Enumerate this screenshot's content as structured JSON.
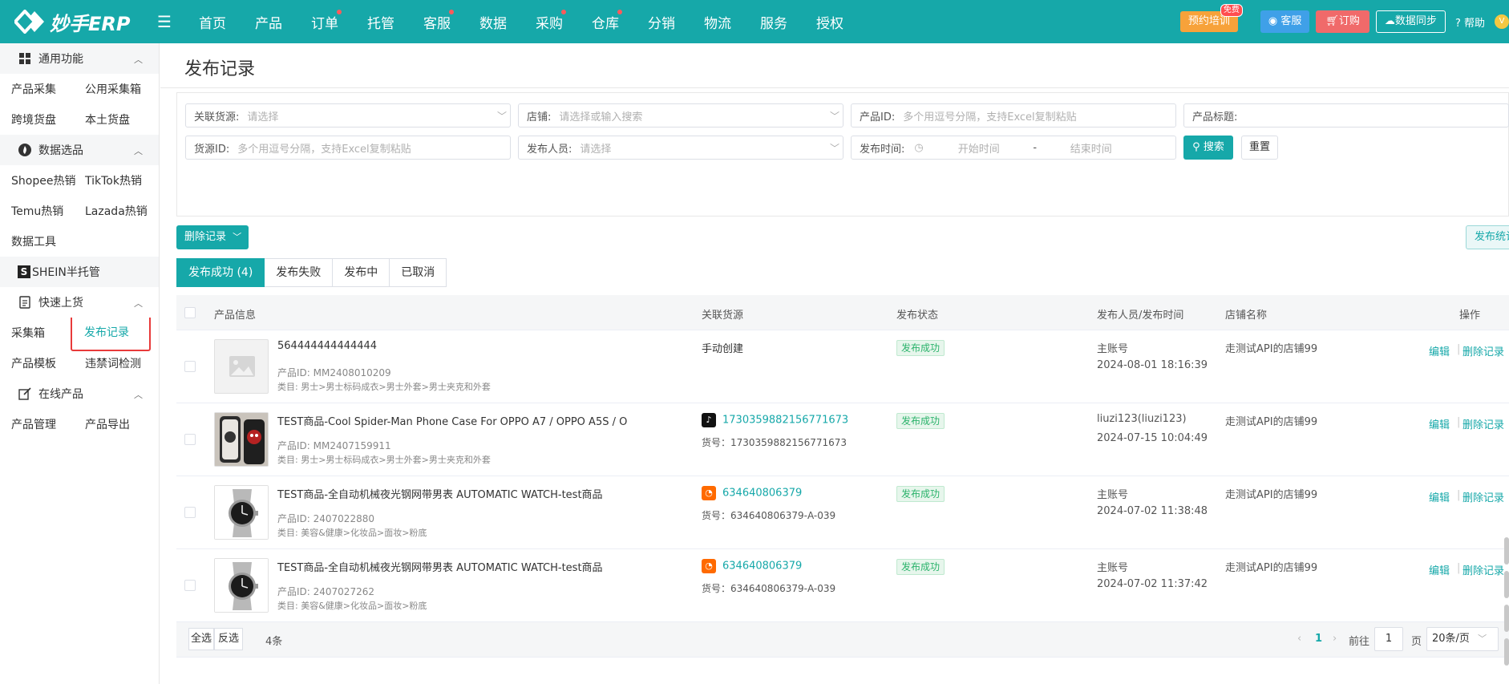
{
  "app": {
    "logo_text": "妙手ERP",
    "nav": [
      {
        "label": "首页",
        "dot": false
      },
      {
        "label": "产品",
        "dot": false
      },
      {
        "label": "订单",
        "dot": true
      },
      {
        "label": "托管",
        "dot": false
      },
      {
        "label": "客服",
        "dot": true
      },
      {
        "label": "数据",
        "dot": false
      },
      {
        "label": "采购",
        "dot": true
      },
      {
        "label": "仓库",
        "dot": true
      },
      {
        "label": "分销",
        "dot": false
      },
      {
        "label": "物流",
        "dot": false
      },
      {
        "label": "服务",
        "dot": false
      },
      {
        "label": "授权",
        "dot": false
      }
    ],
    "training": "预约培训",
    "training_badge": "免费",
    "kefu": "客服",
    "order": "订购",
    "sync": "数据同步",
    "help": "帮助",
    "avatar": "V"
  },
  "sidebar": {
    "groups": [
      {
        "title": "通用功能",
        "icon": "grid-icon",
        "rows": [
          [
            "产品采集",
            "公用采集箱"
          ],
          [
            "跨境货盘",
            "本土货盘"
          ]
        ]
      },
      {
        "title": "数据选品",
        "icon": "fire-icon",
        "rows": [
          [
            "Shopee热销",
            "TikTok热销"
          ],
          [
            "Temu热销",
            "Lazada热销"
          ],
          [
            "数据工具"
          ]
        ]
      },
      {
        "title": "SHEIN半托管",
        "icon": "shein-icon",
        "rows": []
      },
      {
        "title": "快速上货",
        "icon": "document-icon",
        "rows": [
          [
            "采集箱",
            "发布记录"
          ],
          [
            "产品模板",
            "违禁词检测"
          ]
        ]
      },
      {
        "title": "在线产品",
        "icon": "edit-icon",
        "rows": [
          [
            "产品管理",
            "产品导出"
          ]
        ]
      }
    ],
    "active_item": "发布记录"
  },
  "page": {
    "title": "发布记录"
  },
  "filters": {
    "source_label": "关联货源:",
    "source_placeholder": "请选择",
    "shop_label": "店铺:",
    "shop_placeholder": "请选择或输入搜索",
    "product_id_label": "产品ID:",
    "product_id_placeholder": "多个用逗号分隔，支持Excel复制粘贴",
    "product_title_label": "产品标题:",
    "source_id_label": "货源ID:",
    "source_id_placeholder": "多个用逗号分隔，支持Excel复制粘贴",
    "publisher_label": "发布人员:",
    "publisher_placeholder": "请选择",
    "time_label": "发布时间:",
    "start_placeholder": "开始时间",
    "range_sep": "-",
    "end_placeholder": "结束时间",
    "search_btn": "搜索",
    "reset_btn": "重置"
  },
  "toolbar": {
    "delete_record": "删除记录",
    "stats": "发布统计"
  },
  "tabs": [
    {
      "label": "发布成功 (4)",
      "active": true
    },
    {
      "label": "发布失败",
      "active": false
    },
    {
      "label": "发布中",
      "active": false
    },
    {
      "label": "已取消",
      "active": false
    }
  ],
  "table": {
    "headers": {
      "product": "产品信息",
      "source": "关联货源",
      "status": "发布状态",
      "publisher": "发布人员/发布时间",
      "shop": "店铺名称",
      "action": "操作"
    },
    "rows": [
      {
        "name": "564444444444444",
        "product_id": "产品ID: MM2408010209",
        "category": "类目: 男士>男士标码成衣>男士外套>男士夹克和外套",
        "source": "手动创建",
        "source_type": "manual",
        "source_code": "",
        "status": "发布成功",
        "publisher": "主账号",
        "time": "2024-08-01 18:16:39",
        "shop": "走测试API的店铺99",
        "thumb": "placeholder"
      },
      {
        "name": "TEST商品-Cool Spider-Man Phone Case For OPPO A7 / OPPO A5S / O",
        "product_id": "产品ID: MM2407159911",
        "category": "类目: 男士>男士标码成衣>男士外套>男士夹克和外套",
        "source": "1730359882156771673",
        "source_type": "tiktok",
        "source_code": "货号：1730359882156771673",
        "status": "发布成功",
        "publisher": "liuzi123(liuzi123)",
        "time": "2024-07-15 10:04:49",
        "shop": "走测试API的店铺99",
        "thumb": "phonecase"
      },
      {
        "name": "TEST商品-全自动机械夜光钢网带男表 AUTOMATIC WATCH-test商品",
        "product_id": "产品ID: 2407022880",
        "category": "类目: 美容&健康>化妆品>面妆>粉底",
        "source": "634640806379",
        "source_type": "1688",
        "source_code": "货号：634640806379-A-039",
        "status": "发布成功",
        "publisher": "主账号",
        "time": "2024-07-02 11:38:48",
        "shop": "走测试API的店铺99",
        "thumb": "watch"
      },
      {
        "name": "TEST商品-全自动机械夜光钢网带男表 AUTOMATIC WATCH-test商品",
        "product_id": "产品ID: 2407027262",
        "category": "类目: 美容&健康>化妆品>面妆>粉底",
        "source": "634640806379",
        "source_type": "1688",
        "source_code": "货号：634640806379-A-039",
        "status": "发布成功",
        "publisher": "主账号",
        "time": "2024-07-02 11:37:42",
        "shop": "走测试API的店铺99",
        "thumb": "watch"
      }
    ],
    "edit": "编辑",
    "delete": "删除记录"
  },
  "footer": {
    "select_all": "全选",
    "invert": "反选",
    "count": "4条",
    "current_page": "1",
    "goto_label": "前往",
    "goto_value": "1",
    "page_unit": "页",
    "page_size": "20条/页"
  }
}
